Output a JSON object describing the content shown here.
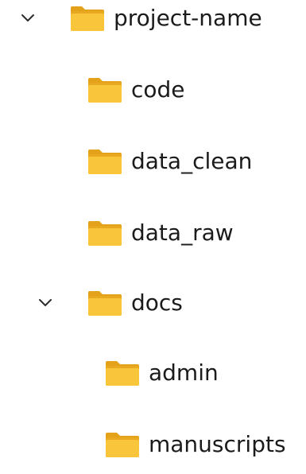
{
  "tree": {
    "root": {
      "label": "project-name",
      "expanded": true,
      "expander_icon": "chevron-down-icon",
      "icon": "folder-icon"
    },
    "children": [
      {
        "label": "code",
        "icon": "folder-icon"
      },
      {
        "label": "data_clean",
        "icon": "folder-icon"
      },
      {
        "label": "data_raw",
        "icon": "folder-icon"
      },
      {
        "label": "docs",
        "expanded": true,
        "expander_icon": "chevron-down-icon",
        "icon": "folder-icon",
        "children": [
          {
            "label": "admin",
            "icon": "folder-icon"
          },
          {
            "label": "manuscripts",
            "icon": "folder-icon"
          }
        ]
      }
    ]
  },
  "colors": {
    "folder_body": "#f9c53b",
    "folder_back": "#e8a820",
    "folder_tab": "#e3a21a",
    "text": "#1b1b1b",
    "chevron": "#2b2b2b"
  }
}
